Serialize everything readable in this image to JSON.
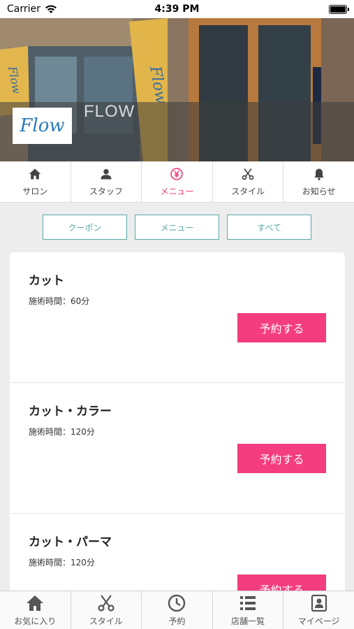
{
  "status": {
    "carrier": "Carrier",
    "time": "4:39 PM"
  },
  "hero": {
    "logo_text": "Flow",
    "salon_name": "FLOW"
  },
  "top_tabs": [
    {
      "label": "サロン",
      "icon": "home-icon"
    },
    {
      "label": "スタッフ",
      "icon": "person-icon"
    },
    {
      "label": "メニュー",
      "icon": "yen-icon",
      "active": true
    },
    {
      "label": "スタイル",
      "icon": "scissors-icon"
    },
    {
      "label": "お知らせ",
      "icon": "bell-icon"
    }
  ],
  "filters": [
    "クーポン",
    "メニュー",
    "すべて"
  ],
  "menu_items": [
    {
      "title": "カット",
      "duration": "施術時間：60分",
      "button": "予約する"
    },
    {
      "title": "カット・カラー",
      "duration": "施術時間：120分",
      "button": "予約する"
    },
    {
      "title": "カット・パーマ",
      "duration": "施術時間：120分",
      "button": "予約する"
    }
  ],
  "bottom_nav": [
    {
      "label": "お気に入り",
      "icon": "home-icon"
    },
    {
      "label": "スタイル",
      "icon": "scissors-icon"
    },
    {
      "label": "予約",
      "icon": "clock-icon"
    },
    {
      "label": "店舗一覧",
      "icon": "list-icon"
    },
    {
      "label": "マイページ",
      "icon": "profile-card-icon"
    }
  ],
  "colors": {
    "accent": "#f43d7f",
    "filter_border": "#5aa8a6",
    "active_tab": "#ee3f7c"
  }
}
